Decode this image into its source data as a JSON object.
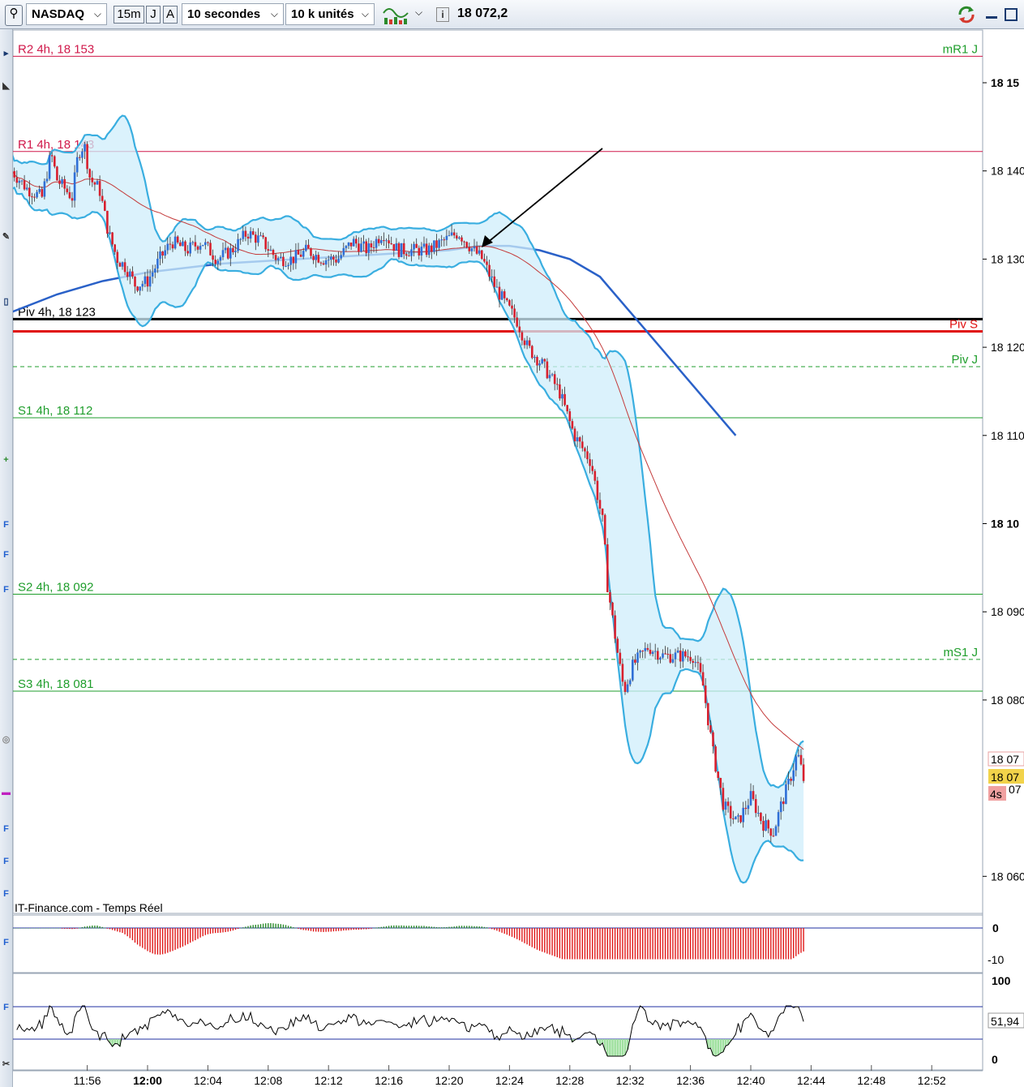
{
  "toolbar": {
    "instrument": "NASDAQ",
    "timeframe": "15m",
    "btn_j": "J",
    "btn_a": "A",
    "interval": "10 secondes",
    "units": "10 k unités",
    "price": "18 072,2",
    "info_icon": "i",
    "refresh_icon": "refresh-icon",
    "colors": {
      "accent": "#d53a2e",
      "green": "#2b8a2b"
    }
  },
  "left_icons": [
    "+",
    "F",
    "F",
    "F",
    "F",
    "F",
    "F",
    "F",
    "F"
  ],
  "chart": {
    "levels": [
      {
        "label": "R2 4h, 18 153",
        "value": 18153,
        "color": "#d0184a",
        "style": "solid",
        "side": "left"
      },
      {
        "label": "mR1 J",
        "value": 18153,
        "color": "#1f9e2c",
        "style": "solid",
        "side": "right"
      },
      {
        "label": "R1 4h, 18 143",
        "value": 18142.2,
        "color": "#d0184a",
        "style": "solid",
        "side": "left"
      },
      {
        "label": "Piv 4h, 18 123",
        "value": 18123.2,
        "color": "#000000",
        "style": "thick",
        "side": "left"
      },
      {
        "label": "Piv S",
        "value": 18121.8,
        "color": "#e01010",
        "style": "thick",
        "side": "right"
      },
      {
        "label": "Piv J",
        "value": 18117.8,
        "color": "#1f9e2c",
        "style": "dash",
        "side": "right"
      },
      {
        "label": "S1 4h, 18 112",
        "value": 18112,
        "color": "#1f9e2c",
        "style": "solid",
        "side": "left"
      },
      {
        "label": "S2 4h, 18 092",
        "value": 18092,
        "color": "#1f9e2c",
        "style": "solid",
        "side": "left"
      },
      {
        "label": "mS1 J",
        "value": 18084.6,
        "color": "#1f9e2c",
        "style": "dash",
        "side": "right"
      },
      {
        "label": "S3 4h, 18 081",
        "value": 18081,
        "color": "#1f9e2c",
        "style": "solid",
        "side": "left"
      }
    ],
    "y_ticks": [
      "18 15",
      "18 140",
      "18 130",
      "18 120",
      "18 110",
      "18 10",
      "18 090",
      "18 080",
      "18 060"
    ],
    "y_ticks_bold": [
      true,
      false,
      false,
      false,
      false,
      true,
      false,
      false,
      false
    ],
    "y_tick_values": [
      18150,
      18140,
      18130,
      18120,
      18110,
      18100,
      18090,
      18080,
      18060
    ],
    "x_ticks": [
      "11:56",
      "12:00",
      "12:04",
      "12:08",
      "12:12",
      "12:16",
      "12:20",
      "12:24",
      "12:28",
      "12:32",
      "12:36",
      "12:40",
      "12:44",
      "12:48",
      "12:52"
    ],
    "x_ticks_bold": [
      false,
      true,
      false,
      false,
      false,
      false,
      false,
      false,
      false,
      false,
      false,
      false,
      false,
      false,
      false
    ],
    "price_tag_last": "18 07",
    "price_tag_current": "18 07",
    "price_tag_suffix": "07",
    "countdown": "4s",
    "source": "IT-Finance.com - Temps Réel"
  },
  "osc1": {
    "ticks": [
      "0",
      "-10"
    ]
  },
  "osc2": {
    "ticks": [
      "100",
      "51,94",
      "0"
    ]
  }
}
